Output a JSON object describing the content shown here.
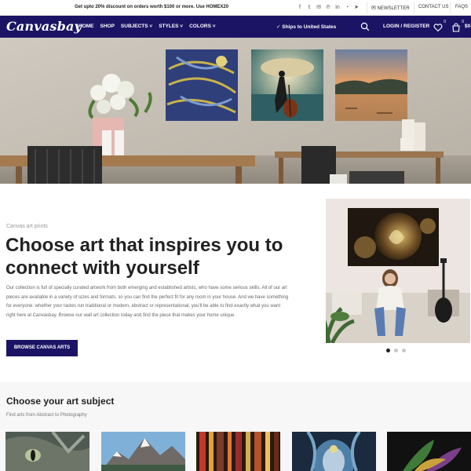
{
  "topbar": {
    "promo": "Get upto 20% discount on orders worth $100 or more. Use HOMEX20",
    "social_icons": [
      "facebook-icon",
      "twitter-icon",
      "email-icon",
      "pinterest-icon",
      "linkedin-icon",
      "whatsapp-icon",
      "telegram-icon"
    ],
    "social_glyphs": [
      "f",
      "𝕥",
      "✉",
      "℗",
      "in",
      "◔",
      "➤"
    ],
    "newsletter": "NEWSLETTER",
    "contact": "CONTACT US",
    "faqs": "FAQS"
  },
  "header": {
    "logo": "Canvasbay",
    "nav": [
      "HOME",
      "SHOP",
      "SUBJECTS ˅",
      "STYLES ˅",
      "COLORS ˅"
    ],
    "ships": "✓ Ships to United States",
    "login": "LOGIN / REGISTER",
    "wishlist_count": "0",
    "cart_count": "0",
    "cart_total": "$0"
  },
  "intro": {
    "eyebrow": "Canvas art prints",
    "headline": "Choose art that inspires you to connect with yourself",
    "body": "Our collection is full of specially curated artwork from both emerging and established artists, who have some serious skills. All of our art pieces are available in a variety of sizes and formats, so you can find the perfect fit for any room in your house. And we have something for everyone: whether your tastes run traditional or modern, abstract or representational, you'll be able to find exactly what you want right here at Canvasbay. Browse our wall art collection today and find the piece that makes your home unique.",
    "cta": "BROWSE CANVAS ARTS"
  },
  "carousel": {
    "slide_count": 3,
    "active_index": 0
  },
  "subjects": {
    "title": "Choose your art subject",
    "subtitle": "Find arts from Abstract to Photography"
  },
  "colors": {
    "brand": "#1b1464",
    "white": "#ffffff"
  }
}
